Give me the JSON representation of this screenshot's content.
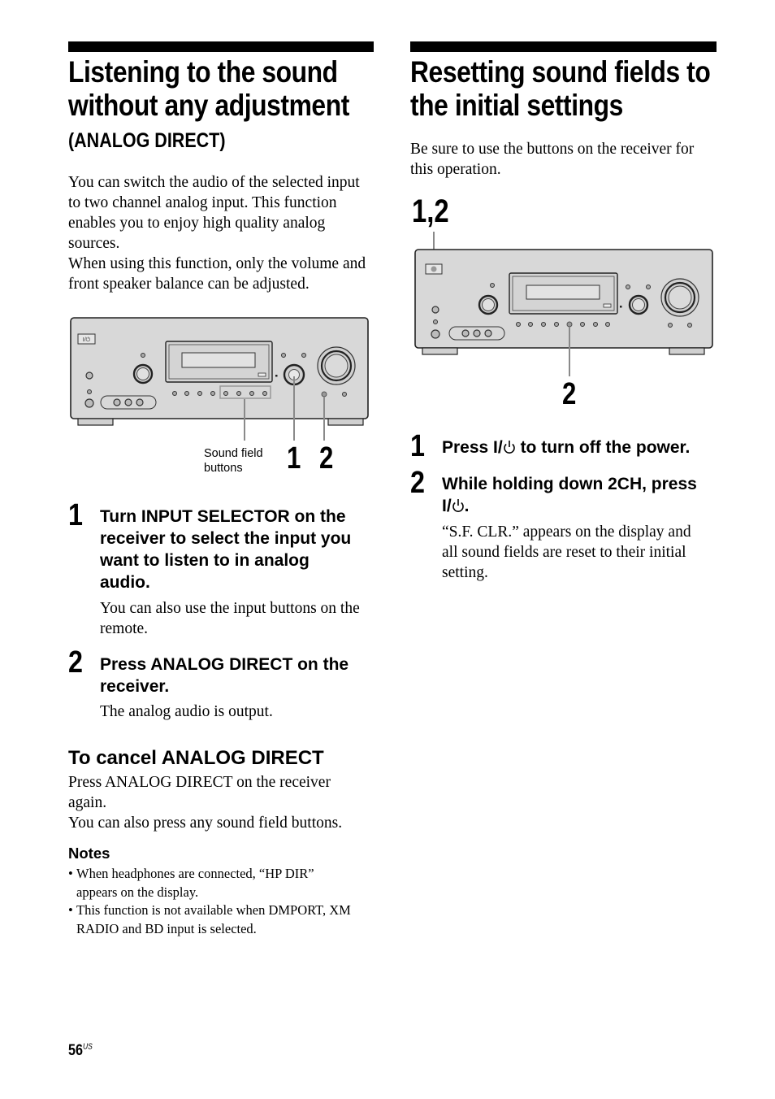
{
  "left_section": {
    "title_lines": [
      "Listening to the sound",
      "without any adjustment"
    ],
    "subtitle": "(ANALOG DIRECT)",
    "intro": [
      "You can switch the audio of the selected input",
      "to two channel analog input. This function",
      "enables you to enjoy high quality analog",
      "sources.",
      "When using this function, only the volume and",
      "front speaker balance can be adjusted."
    ],
    "figure": {
      "callout_label_lines": [
        "Sound field",
        "buttons"
      ],
      "callout_1": "1",
      "callout_2": "2",
      "power_button_label": "I/⏻"
    },
    "steps": [
      {
        "number": "1",
        "title_lines": [
          "Turn INPUT SELECTOR on the",
          "receiver to select the input you",
          "want to listen to in analog",
          "audio."
        ],
        "body_lines": [
          "You can also use the input buttons on the",
          "remote."
        ]
      },
      {
        "number": "2",
        "title_lines": [
          "Press ANALOG DIRECT on the",
          "receiver."
        ],
        "body_lines": [
          "The analog audio is output."
        ]
      }
    ],
    "cancel": {
      "heading": "To cancel ANALOG DIRECT",
      "body_lines": [
        "Press ANALOG DIRECT on the receiver",
        "again.",
        "You can also press any sound field buttons."
      ]
    },
    "notes": {
      "heading": "Notes",
      "items": [
        [
          "When headphones are connected, “HP DIR”",
          "appears on the display."
        ],
        [
          "This function is not available when DMPORT, XM",
          "RADIO and BD input is selected."
        ]
      ]
    }
  },
  "right_section": {
    "title_lines": [
      "Resetting sound fields to",
      "the initial settings"
    ],
    "intro": [
      "Be sure to use the buttons on the receiver for",
      "this operation."
    ],
    "figure": {
      "callout_top": "1,2",
      "callout_bottom": "2"
    },
    "steps": [
      {
        "number": "1",
        "title_pre": "Press I/",
        "title_post": " to turn off the power."
      },
      {
        "number": "2",
        "title_line1": "While holding down 2CH, press",
        "title_line2_pre": "I/",
        "title_line2_post": ".",
        "body_lines": [
          "“S.F. CLR.” appears on the display and",
          "all sound fields are reset to their initial",
          "setting."
        ]
      }
    ]
  },
  "footer": {
    "page_number": "56",
    "page_suffix": "US"
  }
}
